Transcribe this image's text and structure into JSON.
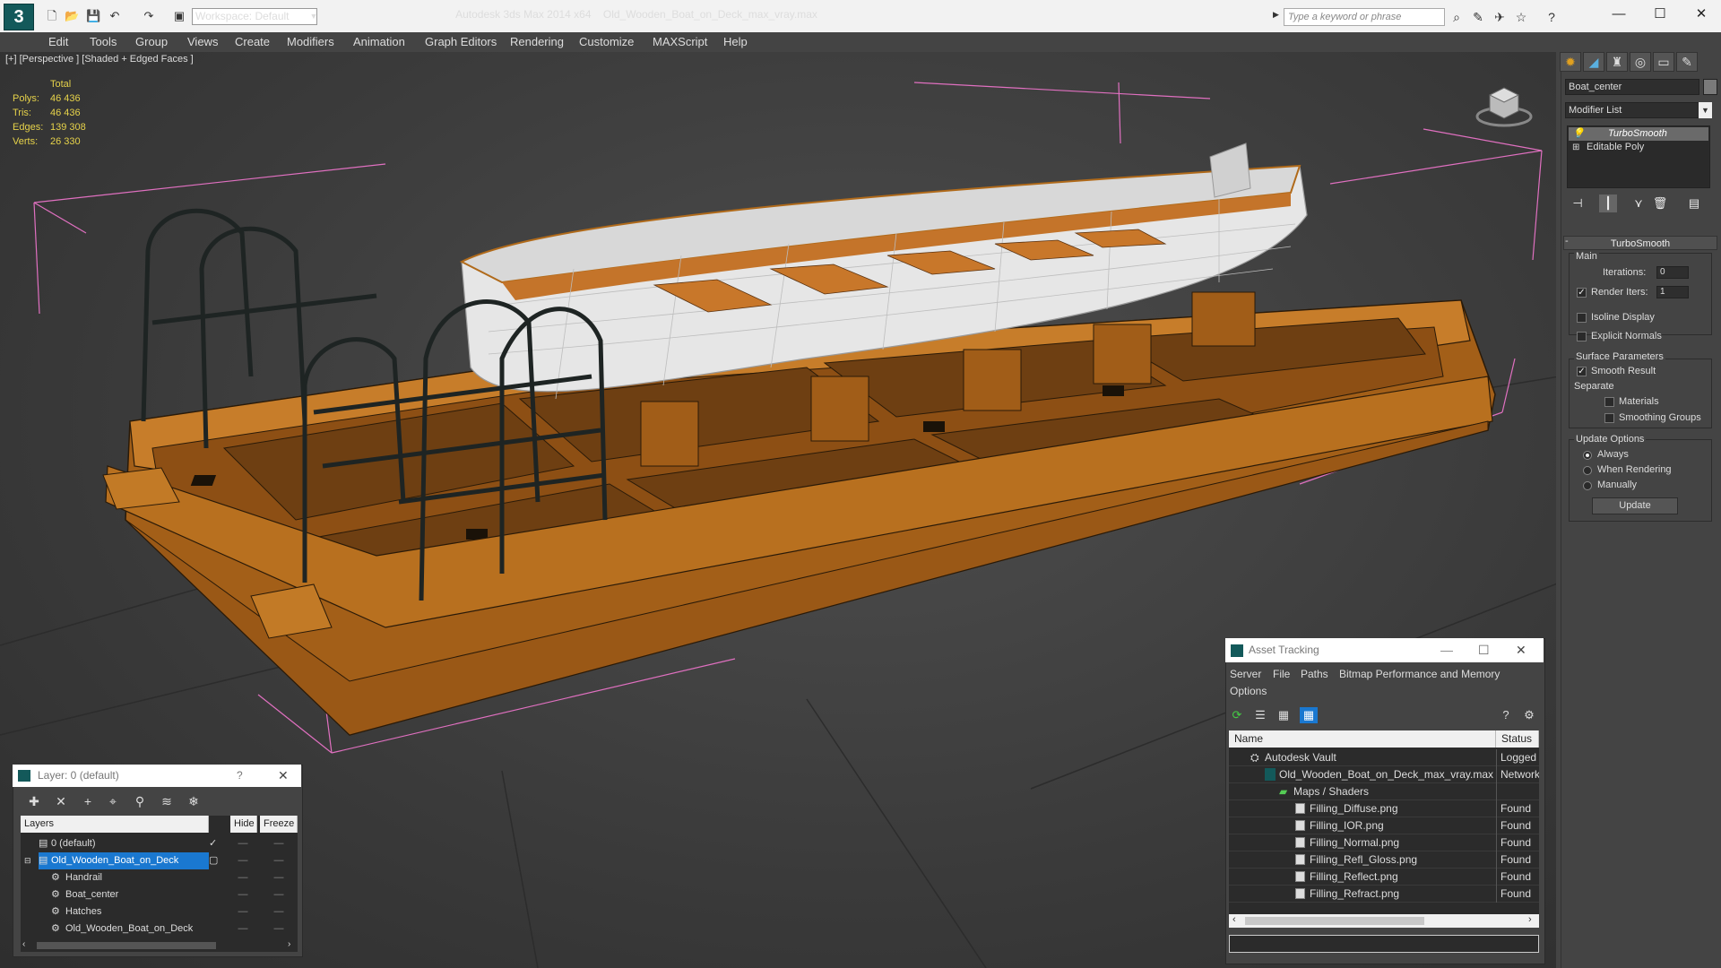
{
  "titlebar": {
    "workspace": "Workspace: Default",
    "app_name": "Autodesk 3ds Max  2014 x64",
    "file_name": "Old_Wooden_Boat_on_Deck_max_vray.max",
    "search_placeholder": "Type a keyword or phrase"
  },
  "menu": [
    "Edit",
    "Tools",
    "Group",
    "Views",
    "Create",
    "Modifiers",
    "Animation",
    "Graph Editors",
    "Rendering",
    "Customize",
    "MAXScript",
    "Help"
  ],
  "viewport": {
    "label": "[+] [Perspective ] [Shaded + Edged Faces ]",
    "stats": {
      "header": "Total",
      "rows": [
        {
          "label": "Polys:",
          "value": "46 436"
        },
        {
          "label": "Tris:",
          "value": "46 436"
        },
        {
          "label": "Edges:",
          "value": "139 308"
        },
        {
          "label": "Verts:",
          "value": "26 330"
        }
      ]
    }
  },
  "command_panel": {
    "object_name": "Boat_center",
    "modifier_list": "Modifier List",
    "stack": [
      "TurboSmooth",
      "Editable Poly"
    ],
    "turbosmooth": {
      "title": "TurboSmooth",
      "main_label": "Main",
      "iterations_label": "Iterations:",
      "iterations": "0",
      "render_iters_label": "Render Iters:",
      "render_iters": "1",
      "render_iters_checked": true,
      "isoline_label": "Isoline Display",
      "explicit_label": "Explicit Normals",
      "surface_label": "Surface Parameters",
      "smooth_label": "Smooth Result",
      "smooth_checked": true,
      "separate_label": "Separate",
      "materials_label": "Materials",
      "smoothing_groups_label": "Smoothing Groups",
      "update_options_label": "Update Options",
      "always_label": "Always",
      "when_rendering_label": "When Rendering",
      "manually_label": "Manually",
      "update_button": "Update"
    }
  },
  "layer_dialog": {
    "title": "Layer: 0 (default)",
    "help": "?",
    "columns": [
      "Layers",
      "Hide",
      "Freeze"
    ],
    "rows": [
      {
        "name": "0 (default)",
        "indent": 1
      },
      {
        "name": "Old_Wooden_Boat_on_Deck",
        "indent": 1
      },
      {
        "name": "Handrail",
        "indent": 2
      },
      {
        "name": "Boat_center",
        "indent": 2
      },
      {
        "name": "Hatches",
        "indent": 2
      },
      {
        "name": "Old_Wooden_Boat_on_Deck",
        "indent": 2
      }
    ]
  },
  "asset_tracking": {
    "title": "Asset Tracking",
    "menu": [
      "Server",
      "File",
      "Paths",
      "Bitmap Performance and Memory",
      "Options"
    ],
    "columns": [
      "Name",
      "Status"
    ],
    "rows": [
      {
        "name": "Autodesk Vault",
        "status": "Logged Out",
        "indent": 1
      },
      {
        "name": "Old_Wooden_Boat_on_Deck_max_vray.max",
        "status": "Network",
        "indent": 2
      },
      {
        "name": "Maps / Shaders",
        "status": "",
        "indent": 3
      },
      {
        "name": "Filling_Diffuse.png",
        "status": "Found",
        "indent": 4
      },
      {
        "name": "Filling_IOR.png",
        "status": "Found",
        "indent": 4
      },
      {
        "name": "Filling_Normal.png",
        "status": "Found",
        "indent": 4
      },
      {
        "name": "Filling_Refl_Gloss.png",
        "status": "Found",
        "indent": 4
      },
      {
        "name": "Filling_Reflect.png",
        "status": "Found",
        "indent": 4
      },
      {
        "name": "Filling_Refract.png",
        "status": "Found",
        "indent": 4
      }
    ]
  }
}
